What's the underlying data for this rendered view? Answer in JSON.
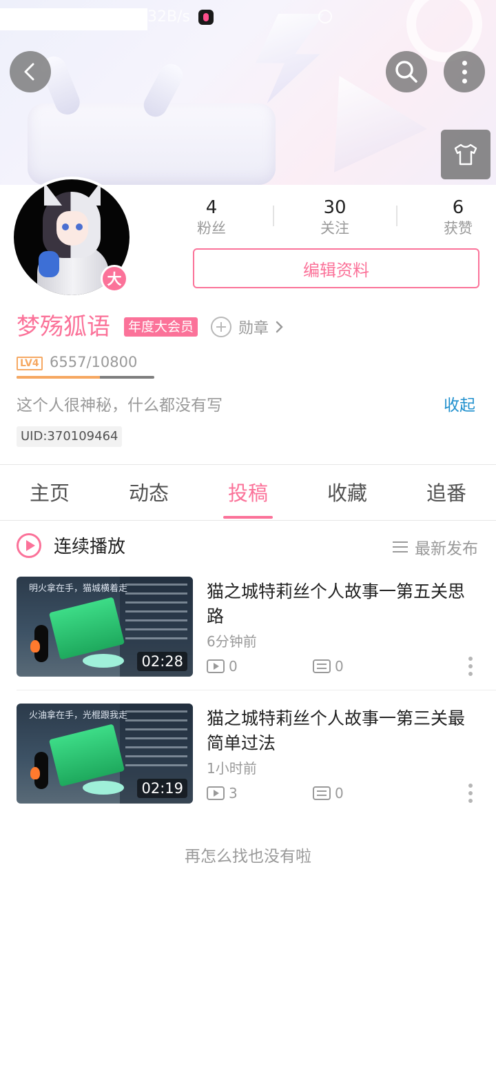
{
  "status_bar": {
    "speed": "32B/s"
  },
  "profile": {
    "username": "梦殇狐语",
    "vip_tag": "年度大会员",
    "vip_badge": "大",
    "medal_label": "勋章",
    "level_badge": "LV4",
    "level_progress": "6557/10800",
    "level_fraction": 0.607,
    "bio": "这个人很神秘，什么都没有写",
    "collapse_label": "收起",
    "uid": "UID:370109464",
    "edit_button": "编辑资料"
  },
  "stats": [
    {
      "value": "4",
      "label": "粉丝"
    },
    {
      "value": "30",
      "label": "关注"
    },
    {
      "value": "6",
      "label": "获赞"
    }
  ],
  "tabs": [
    {
      "label": "主页"
    },
    {
      "label": "动态"
    },
    {
      "label": "投稿",
      "active": true
    },
    {
      "label": "收藏"
    },
    {
      "label": "追番"
    }
  ],
  "playlist": {
    "continuous_label": "连续播放",
    "sort_label": "最新发布"
  },
  "videos": [
    {
      "title": "猫之城特莉丝个人故事一第五关思路",
      "time": "6分钟前",
      "plays": "0",
      "danmaku": "0",
      "duration": "02:28",
      "thumb_caption": "明火拿在手，猫城横着走"
    },
    {
      "title": "猫之城特莉丝个人故事一第三关最简单过法",
      "time": "1小时前",
      "plays": "3",
      "danmaku": "0",
      "duration": "02:19",
      "thumb_caption": "火油拿在手，光棍跟我走"
    }
  ],
  "end_text": "再怎么找也没有啦",
  "colors": {
    "accent": "#fb7299",
    "link": "#1e8fcd",
    "level": "#f6a862"
  }
}
